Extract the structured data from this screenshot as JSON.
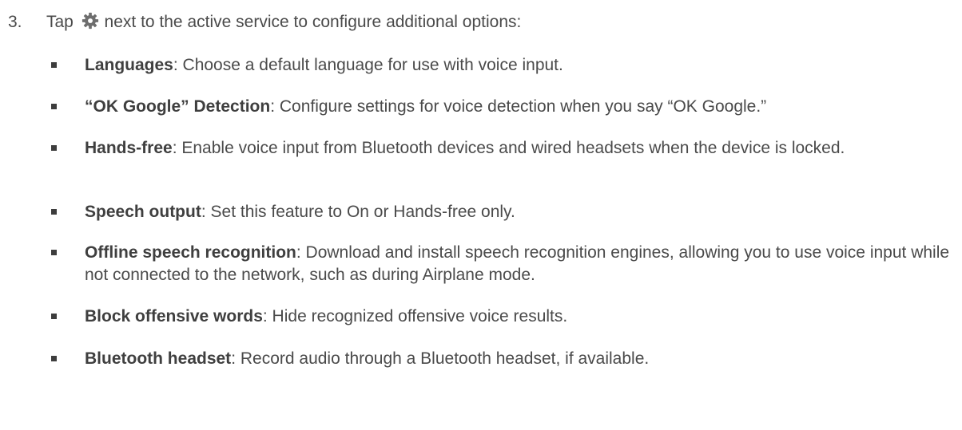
{
  "step": {
    "number": "3.",
    "text_before": "Tap",
    "icon": "gear-icon",
    "text_after": "next to the active service to configure additional options:"
  },
  "options": [
    {
      "term": "Languages",
      "description": ": Choose a default language for use with voice input."
    },
    {
      "term": "“OK Google” Detection",
      "description": ": Configure settings for voice detection when you say “OK Google.”"
    },
    {
      "term": "Hands-free",
      "description": ": Enable voice input from Bluetooth devices and wired headsets when the device is locked."
    },
    {
      "term": "Speech output",
      "description": ": Set this feature to On or Hands-free only."
    },
    {
      "term": "Offline speech recognition",
      "description": ": Download and install speech recognition engines, allowing you to use voice input while not connected to the network, such as during Airplane mode."
    },
    {
      "term": "Block offensive words",
      "description": ": Hide recognized offensive voice results."
    },
    {
      "term": "Bluetooth headset",
      "description": ": Record audio through a Bluetooth headset, if available."
    }
  ],
  "colors": {
    "text": "#4a4a4a",
    "icon": "#6e6e6e"
  }
}
